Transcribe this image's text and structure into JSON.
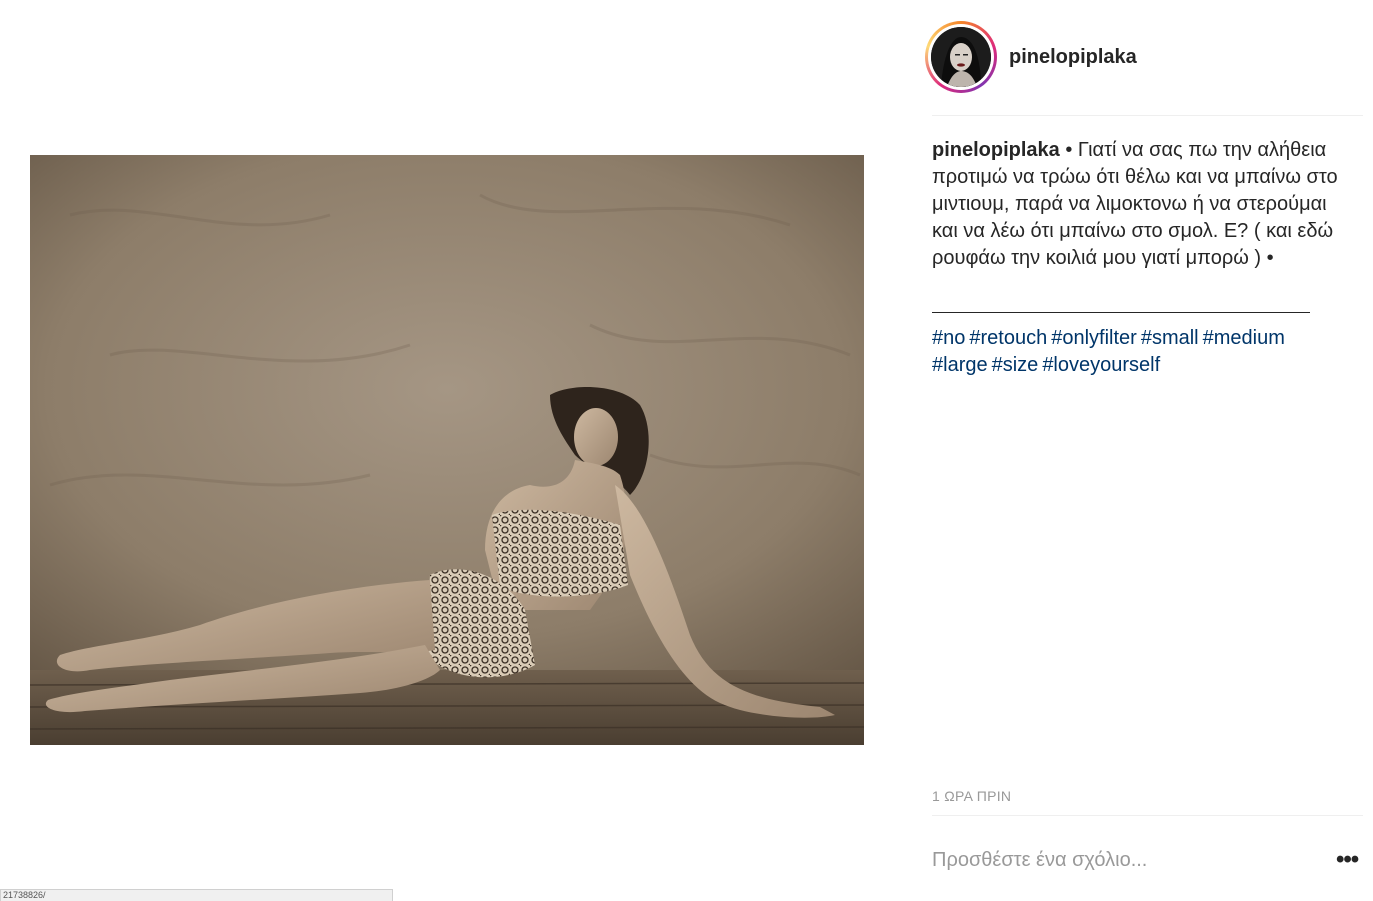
{
  "post": {
    "image": {
      "description_icon": "photo-icon"
    }
  },
  "header": {
    "username": "pinelopiplaka"
  },
  "caption": {
    "username": "pinelopiplaka",
    "text": " • Γιατί να σας πω την αλήθεια προτιμώ να τρώω ότι θέλω και να μπαίνω στο μιντιουμ, παρά να λιμοκτονω ή να στερούμαι και να λέω ότι μπαίνω στο σμολ. Ε? ( και εδώ ρουφάω την κοιλιά μου γιατί μπορώ ) •"
  },
  "hashtags": [
    "#no",
    "#retouch",
    "#onlyfilter",
    "#small",
    "#medium",
    "#large",
    "#size",
    "#loveyourself"
  ],
  "timestamp": "1 ΩΡΑ ΠΡΙΝ",
  "comment": {
    "placeholder": "Προσθέστε ένα σχόλιο..."
  },
  "more_icon": "ellipsis-icon",
  "more_label": "•••",
  "statusbar": {
    "text": "21738826/"
  },
  "colors": {
    "hashtag": "#003569",
    "muted": "#999999",
    "text": "#262626"
  }
}
